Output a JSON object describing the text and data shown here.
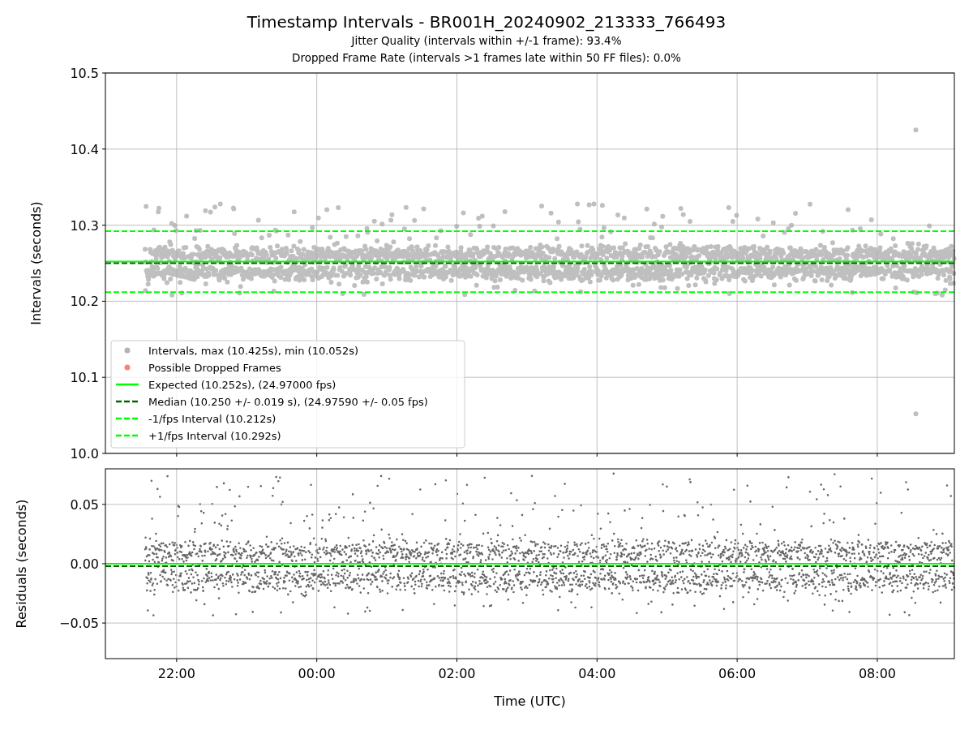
{
  "figure": {
    "title": "Timestamp Intervals - BR001H_20240902_213333_766493",
    "subtitles": [
      "Jitter Quality (intervals within +/-1 frame): 93.4%",
      "Dropped Frame Rate (intervals >1 frames late within 50 FF files): 0.0%"
    ]
  },
  "intervals_panel": {
    "legend_markers": [
      {
        "label": "Intervals, max (10.425s), min (10.052s)",
        "color": "#b3b3b3"
      },
      {
        "label": "Possible Dropped Frames",
        "color": "#ff7f7f"
      }
    ],
    "chart_data": {
      "type": "line",
      "ylabel": "Intervals (seconds)",
      "grid": true,
      "legend": true,
      "x": [
        "2024-09-02 20:59",
        "2024-09-03 09:06"
      ],
      "xlim": [
        "2024-09-02 20:59",
        "2024-09-03 09:06"
      ],
      "ylim": [
        10.0,
        10.5
      ],
      "yticks": [
        {
          "value": 10.0,
          "label": "10.0"
        },
        {
          "value": 10.1,
          "label": "10.1"
        },
        {
          "value": 10.2,
          "label": "10.2"
        },
        {
          "value": 10.3,
          "label": "10.3"
        },
        {
          "value": 10.4,
          "label": "10.4"
        },
        {
          "value": 10.5,
          "label": "10.5"
        }
      ],
      "series": [
        {
          "name": "Expected (10.252s), (24.97000 fps)",
          "color": "#00ff00",
          "line_style": "solid",
          "values": [
            10.252,
            10.252
          ]
        },
        {
          "name": "Median (10.250 +/- 0.019 s), (24.97590 +/- 0.05 fps)",
          "color": "#006400",
          "line_style": "dashed",
          "values": [
            10.25,
            10.25
          ]
        },
        {
          "name": "-1/fps Interval (10.212s)",
          "color": "#00ff00",
          "line_style": "dashed",
          "values": [
            10.212,
            10.212
          ]
        },
        {
          "name": "+1/fps Interval (10.292s)",
          "color": "#00ff00",
          "line_style": "dashed",
          "values": [
            10.292,
            10.292
          ]
        }
      ]
    }
  },
  "residuals_panel": {
    "chart_data": {
      "type": "line",
      "xlabel": "Time (UTC)",
      "ylabel": "Residuals (seconds)",
      "grid": true,
      "x": [
        "2024-09-02 20:59",
        "2024-09-03 09:06"
      ],
      "xlim": [
        "2024-09-02 20:59",
        "2024-09-03 09:06"
      ],
      "ylim": [
        -0.08,
        0.08
      ],
      "xticks": [
        {
          "value": "2024-09-02 22:00",
          "label": "22:00"
        },
        {
          "value": "2024-09-03 00:00",
          "label": "00:00"
        },
        {
          "value": "2024-09-03 02:00",
          "label": "02:00"
        },
        {
          "value": "2024-09-03 04:00",
          "label": "04:00"
        },
        {
          "value": "2024-09-03 06:00",
          "label": "06:00"
        },
        {
          "value": "2024-09-03 08:00",
          "label": "08:00"
        }
      ],
      "yticks": [
        {
          "value": 0.05,
          "label": "0.05"
        },
        {
          "value": 0,
          "label": "0.00"
        },
        {
          "value": -0.05,
          "label": "−0.05"
        }
      ],
      "series": [
        {
          "color": "#00ff00",
          "line_style": "solid",
          "values": [
            0,
            0
          ]
        },
        {
          "color": "#006400",
          "line_style": "dashed",
          "values": [
            -0.002,
            -0.002
          ]
        }
      ]
    }
  }
}
